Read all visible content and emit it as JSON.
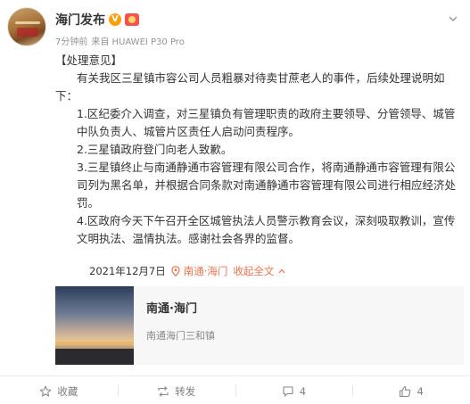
{
  "post": {
    "author_name": "海门发布",
    "meta_time": "7分钟前",
    "meta_source": "来自 HUAWEI P30 Pro",
    "paragraphs": [
      "【处理意见】",
      "有关我区三星镇市容公司人员粗暴对待卖甘蔗老人的事件，后续处理说明如下：",
      "1.区纪委介入调查，对三星镇负有管理职责的政府主要领导、分管领导、城管中队负责人、城管片区责任人启动问责程序。",
      "2.三星镇政府登门向老人致歉。",
      "3.三星镇终止与南通静通市容管理有限公司合作，将南通静通市容管理有限公司列为黑名单，并根据合同条款对南通静通市容管理有限公司进行相应经济处罚。",
      "4.区政府今天下午召开全区城管执法人员警示教育会议，深刻吸取教训，宣传文明执法、温情执法。感谢社会各界的监督。"
    ],
    "date": "2021年12月7日",
    "location": "南通·海门",
    "collapse_label": "收起全文",
    "location_card": {
      "title": "南通·海门",
      "subtitle": "南通海门三和镇"
    }
  },
  "actions": {
    "favorite_label": "收藏",
    "repost_label": "转发",
    "comment_count": "4",
    "like_count": "4"
  },
  "colors": {
    "accent": "#eb7350",
    "vip": "#ffa00a"
  },
  "icons": [
    "vip-icon",
    "medal-icon",
    "more-icon",
    "location-pin-icon",
    "chevron-up-icon",
    "star-icon",
    "repost-icon",
    "comment-icon",
    "thumbs-up-icon"
  ]
}
